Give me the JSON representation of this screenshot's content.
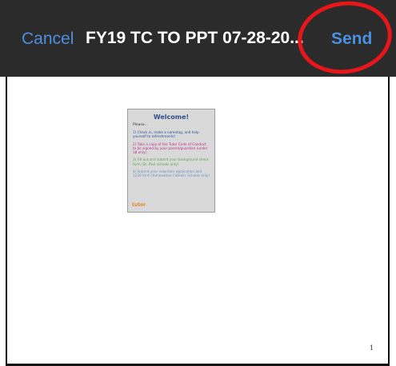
{
  "header": {
    "cancel_label": "Cancel",
    "title": "FY19 TC TO PPT 07-28-20...",
    "send_label": "Send"
  },
  "slide": {
    "title": "Welcome!",
    "please": "Please...",
    "items": [
      {
        "text": "1) Check in, make a nametag, and help yourself to refreshments!",
        "color": "#2d4f9e"
      },
      {
        "text": "2) Take a copy of the Tutor Code of Conduct to be signed by your parent/guardian (under 18 only)",
        "color": "#c0308a"
      },
      {
        "text": "3) Fill out and submit your background check form (St. Paul schools only)",
        "color": "#5aa84a"
      },
      {
        "text": "4) Submit your volunteer application and 1230 form (Annexation Catholic Schools only)",
        "color": "#6a8fc8"
      }
    ],
    "logo": "tutor"
  },
  "page_number": "1",
  "colors": {
    "bar": "#2b2b2b",
    "accent": "#4a8fe0",
    "highlight_circle": "#e8161b"
  }
}
